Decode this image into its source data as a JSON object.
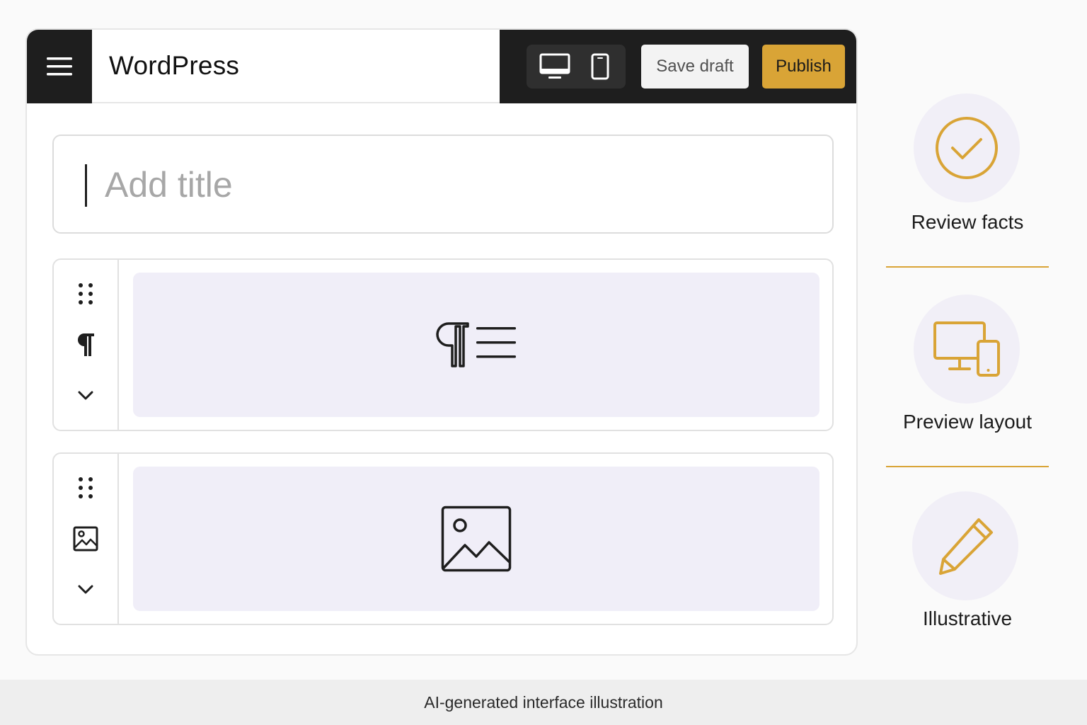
{
  "app": {
    "brand": "WordPress"
  },
  "toolbar": {
    "menu_icon": "hamburger-menu-icon",
    "desktop_icon": "desktop-monitor-icon",
    "mobile_icon": "mobile-phone-icon",
    "save_label": "Save draft",
    "publish_label": "Publish"
  },
  "title_field": {
    "placeholder": "Add title",
    "value": ""
  },
  "blocks": [
    {
      "type": "paragraph",
      "rail_icons": [
        "drag-handle-icon",
        "pilcrow-icon",
        "chevron-down-icon"
      ],
      "preview_icon": "paragraph-lines-icon"
    },
    {
      "type": "image",
      "rail_icons": [
        "drag-handle-icon",
        "image-icon",
        "chevron-down-icon"
      ],
      "preview_icon": "image-placeholder-icon"
    }
  ],
  "sidebar": {
    "items": [
      {
        "label": "Review facts",
        "icon": "check-circle-icon"
      },
      {
        "label": "Preview layout",
        "icon": "devices-icon"
      },
      {
        "label": "Illustrative",
        "icon": "pencil-icon"
      }
    ]
  },
  "footer": {
    "caption": "AI-generated interface illustration"
  },
  "colors": {
    "accent": "#d9a436",
    "toolbar_dark": "#1e1e1e",
    "block_fill": "#f0eef8",
    "circle_fill": "#f1eff7"
  }
}
